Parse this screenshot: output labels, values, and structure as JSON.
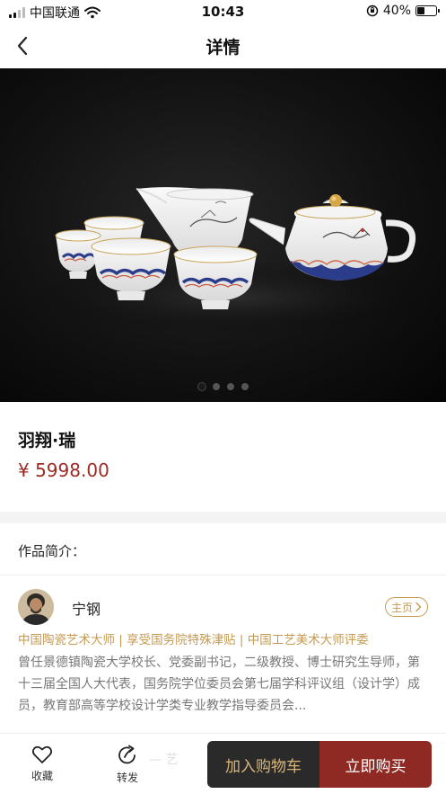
{
  "status_bar": {
    "carrier": "中国联通",
    "time": "10:43",
    "battery": "40%",
    "battery_level": 0.4
  },
  "nav": {
    "title": "详情",
    "back_icon": "chevron-left-icon"
  },
  "gallery": {
    "image_subject": "white porcelain tea set on black background",
    "page_count": 4,
    "active_index": 0
  },
  "product": {
    "title": "羽翔·瑞",
    "price": "¥ 5998.00"
  },
  "intro": {
    "heading": "作品简介：",
    "artist": {
      "name": "宁钢",
      "home_label": "主页",
      "titles": "中国陶瓷艺术大师 | 享受国务院特殊津贴 | 中国工艺美术大师评委",
      "bio": "曾任景德镇陶瓷大学校长、党委副书记，二级教授、博士研究生导师，第十三届全国人大代表，国务院学位委员会第七届学科评议组（设计学）成员，教育部高等学校设计学类专业教学指导委员会..."
    }
  },
  "bottom_bar": {
    "favorite_label": "收藏",
    "share_label": "转发",
    "ghost_text": "— 艺",
    "add_to_cart_label": "加入购物车",
    "buy_now_label": "立即购买"
  },
  "colors": {
    "accent_gold": "#c59a52",
    "price_red": "#9e2a22",
    "buy_red": "#8e2a23",
    "cart_dark": "#2a2a2a"
  }
}
